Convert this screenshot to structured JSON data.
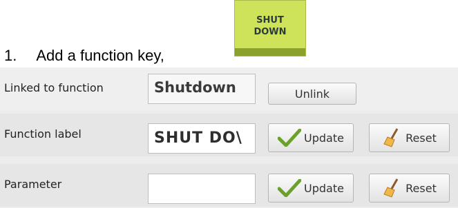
{
  "step": {
    "number": "1.",
    "text": "Add a function key,"
  },
  "function_key": {
    "line1": "SHUT",
    "line2": "DOWN",
    "color": "#cfe35a",
    "icon": "shutdown-function-key"
  },
  "rows": {
    "linked": {
      "label": "Linked to function",
      "value": "Shutdown",
      "button": "Unlink"
    },
    "function_label": {
      "label": "Function label",
      "value": "SHUT DO\\",
      "update": "Update",
      "reset": "Reset"
    },
    "parameter": {
      "label": "Parameter",
      "value": "",
      "update": "Update",
      "reset": "Reset"
    }
  },
  "icons": {
    "update": "check-icon",
    "reset": "broom-icon"
  }
}
